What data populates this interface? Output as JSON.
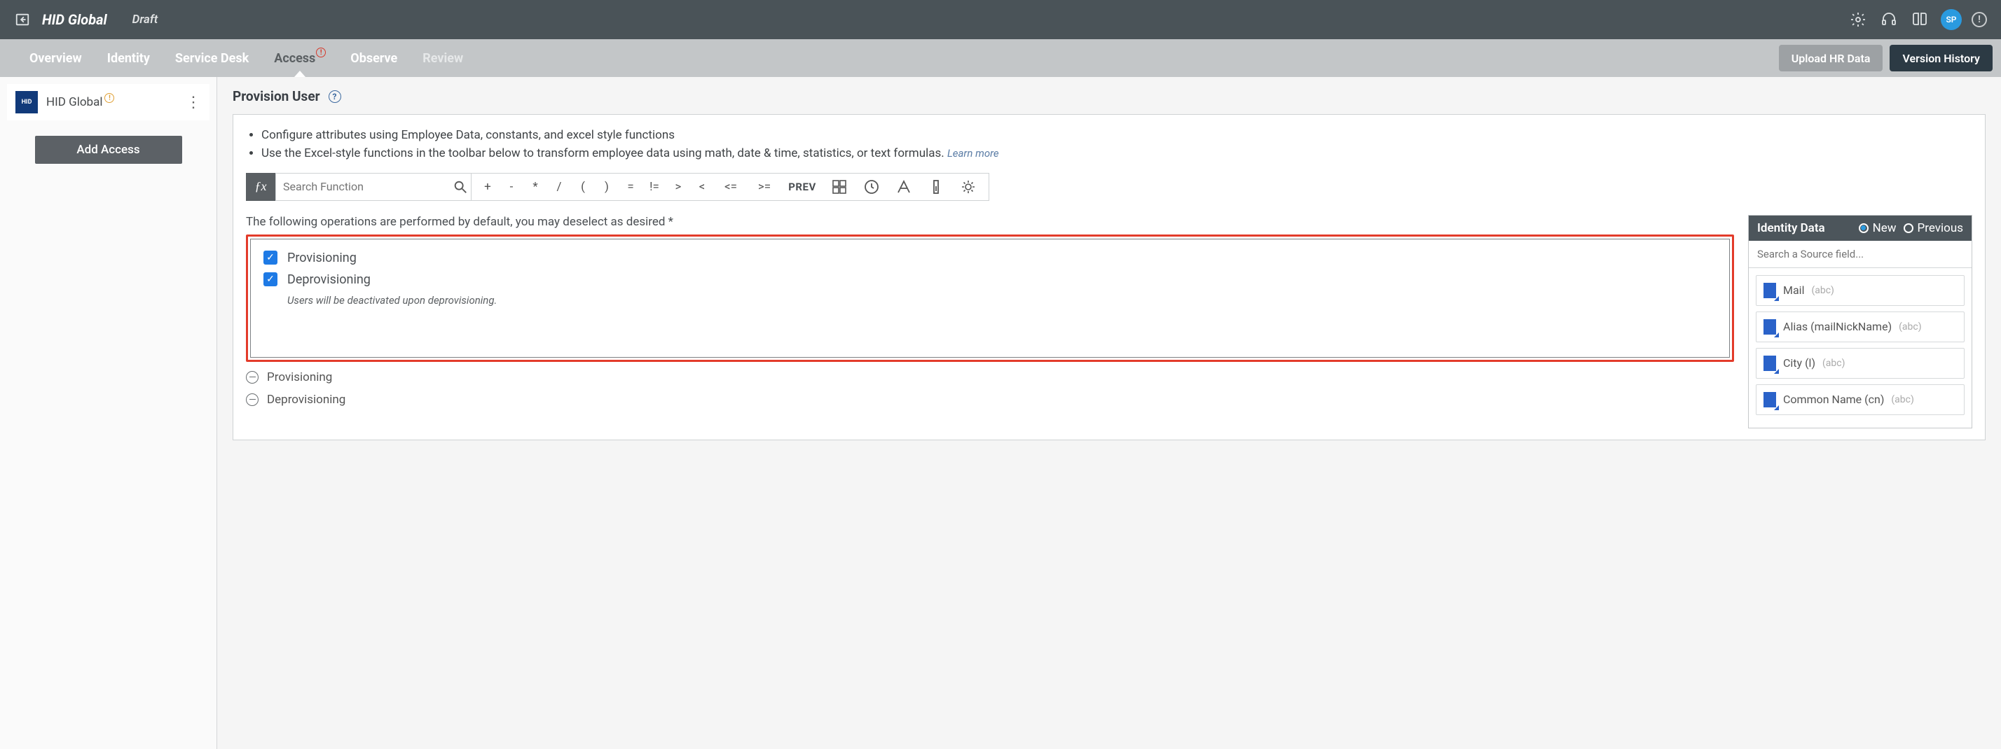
{
  "header": {
    "title": "HID Global",
    "status": "Draft",
    "avatar_initials": "SP"
  },
  "tabs": [
    {
      "label": "Overview",
      "active": false
    },
    {
      "label": "Identity",
      "active": false
    },
    {
      "label": "Service Desk",
      "active": false
    },
    {
      "label": "Access",
      "active": true,
      "warn": true
    },
    {
      "label": "Observe",
      "active": false
    },
    {
      "label": "Review",
      "active": false,
      "dim": true
    }
  ],
  "actions": {
    "upload": "Upload HR Data",
    "history": "Version History"
  },
  "sidebar": {
    "item_name": "HID Global",
    "logo_text": "HID",
    "add_button": "Add Access"
  },
  "page": {
    "title": "Provision User",
    "bullets": [
      "Configure attributes using Employee Data, constants, and excel style functions",
      "Use the Excel-style functions in the toolbar below to transform employee data using math, date & time, statistics, or text formulas."
    ],
    "learn_more": "Learn more",
    "fx_placeholder": "Search Function",
    "fx_ops": [
      "+",
      "-",
      "*",
      "/",
      "(",
      ")",
      "=",
      "!=",
      ">",
      "<",
      "<=",
      ">="
    ],
    "fx_prev": "PREV",
    "instruction": "The following operations are performed by default, you may deselect as desired *",
    "operations": [
      {
        "label": "Provisioning",
        "checked": true,
        "note": null
      },
      {
        "label": "Deprovisioning",
        "checked": true,
        "note": "Users will be deactivated upon deprovisioning."
      }
    ],
    "collapsed": [
      "Provisioning",
      "Deprovisioning"
    ]
  },
  "rightpane": {
    "title": "Identity Data",
    "radio_new": "New",
    "radio_prev": "Previous",
    "search_placeholder": "Search a Source field...",
    "fields": [
      {
        "name": "Mail",
        "hint": "(abc)"
      },
      {
        "name": "Alias (mailNickName)",
        "hint": "(abc)"
      },
      {
        "name": "City (l)",
        "hint": "(abc)"
      },
      {
        "name": "Common Name (cn)",
        "hint": "(abc)"
      }
    ]
  }
}
